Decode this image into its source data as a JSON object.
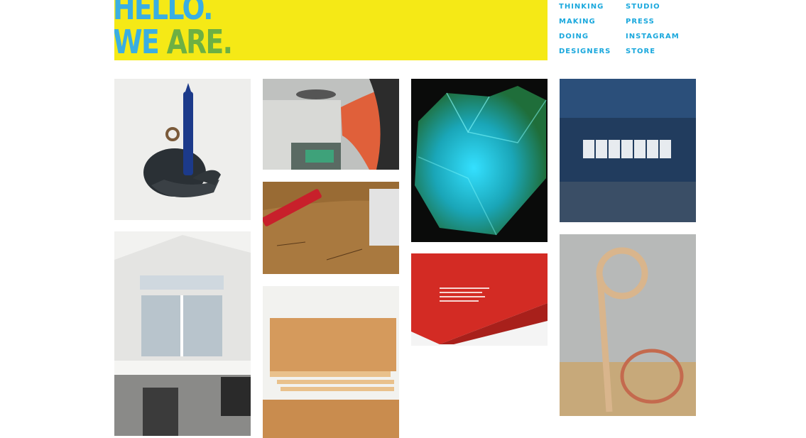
{
  "banner": {
    "line1": "HELLO.",
    "line2_a": "WE",
    "line2_b": "ARE."
  },
  "nav": {
    "col1": [
      "THINKING",
      "MAKING",
      "DOING",
      "DESIGNERS"
    ],
    "col2": [
      "STUDIO",
      "PRESS",
      "INSTAGRAM",
      "STORE"
    ]
  },
  "colors": {
    "banner_bg": "#f5e916",
    "nav_link": "#1aa8dd",
    "banner_blue": "#3aaee2",
    "banner_green": "#6db043"
  },
  "tiles": [
    {
      "icon": "candle-holder-photo"
    },
    {
      "icon": "workshop-hands-photo"
    },
    {
      "icon": "glowing-lamp-photo"
    },
    {
      "icon": "letter-blocks-photo"
    },
    {
      "icon": "cutting-board-photo"
    },
    {
      "icon": "interior-room-photo"
    },
    {
      "icon": "wooden-bed-photo"
    },
    {
      "icon": "red-box-photo"
    },
    {
      "icon": "bent-wood-photo"
    }
  ]
}
